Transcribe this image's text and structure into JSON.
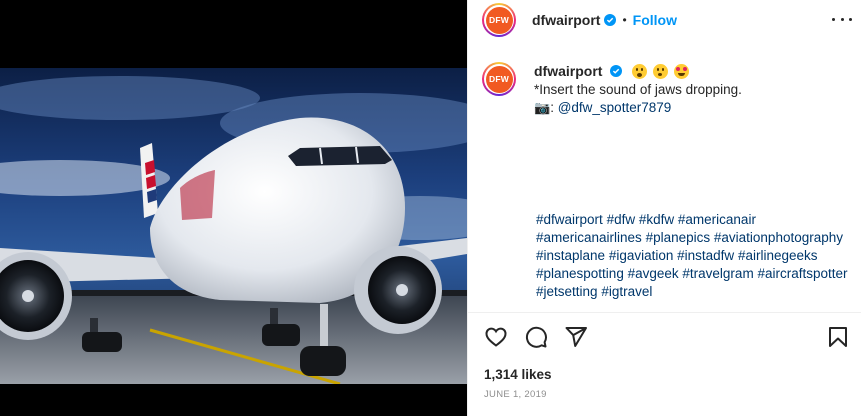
{
  "post": {
    "username": "dfwairport",
    "avatar_text": "DFW",
    "follow_label": "Follow",
    "separator": "•",
    "verified": true
  },
  "caption": {
    "username": "dfwairport",
    "emojis": [
      "astonished-face",
      "hushed-face",
      "star-struck-face"
    ],
    "line1": "*Insert the sound of jaws dropping.",
    "camera_emoji": "📷",
    "credit_sep": ": ",
    "credit": "@dfw_spotter7879"
  },
  "hashtags": [
    "#dfwairport",
    "#dfw",
    "#kdfw",
    "#americanair",
    "#americanairlines",
    "#planepics",
    "#aviationphotography",
    "#instaplane",
    "#igaviation",
    "#instadfw",
    "#airlinegeeks",
    "#planespotting",
    "#avgeek",
    "#travelgram",
    "#aircraftspotter",
    "#jetsetting",
    "#igtravel"
  ],
  "stats": {
    "likes": "1,314 likes",
    "date": "JUNE 1, 2019"
  },
  "colors": {
    "link": "#00376b",
    "follow": "#0095f6",
    "verified": "#0095f6",
    "avatar_bg": "#f15a22",
    "text": "#262626",
    "muted": "#8e8e8e"
  },
  "icons": {
    "like": "heart-icon",
    "comment": "comment-icon",
    "share": "send-icon",
    "save": "bookmark-icon",
    "more": "more-options-icon"
  }
}
